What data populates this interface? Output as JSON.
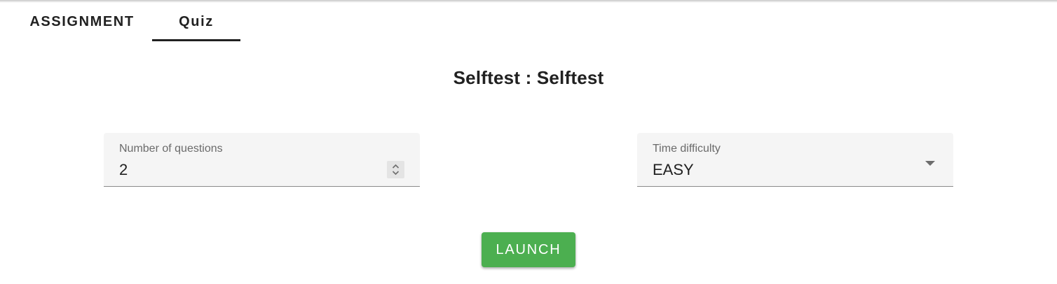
{
  "tabs": [
    {
      "label": "ASSIGNMENT",
      "active": false
    },
    {
      "label": "Quiz",
      "active": true
    }
  ],
  "title": "Selftest : Selftest",
  "questions_field": {
    "label": "Number of questions",
    "value": "2",
    "spinner_icon": "up-down-chevron-icon"
  },
  "difficulty_field": {
    "label": "Time difficulty",
    "value": "EASY",
    "arrow_icon": "caret-down-icon"
  },
  "launch_button": {
    "label": "LAUNCH",
    "color": "#4caf50"
  },
  "colors": {
    "field_bg": "#f5f5f5",
    "text": "#212121",
    "label": "#6b6b6b"
  }
}
